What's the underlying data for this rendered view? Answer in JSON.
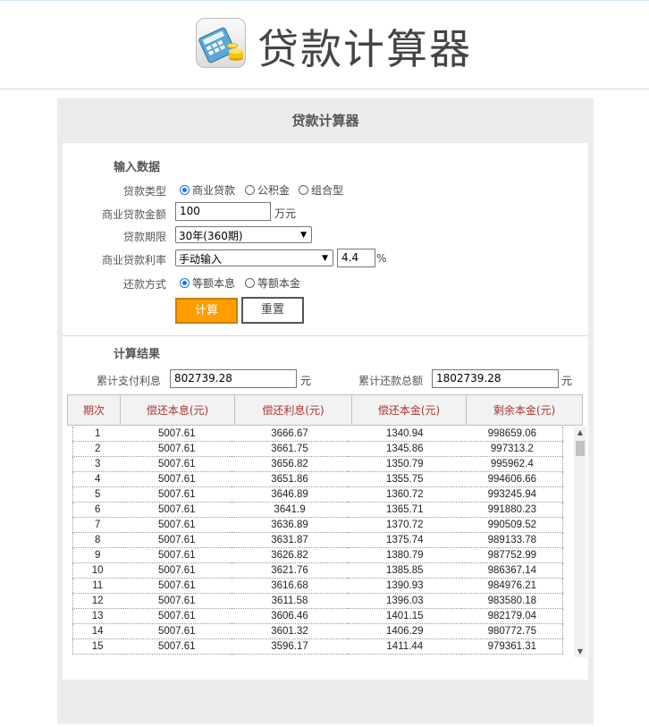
{
  "header": {
    "app_title": "贷款计算器",
    "logo_icon": "calculator-coins-icon"
  },
  "panel": {
    "title": "贷款计算器"
  },
  "input_section": {
    "title": "输入数据",
    "loan_type_label": "贷款类型",
    "loan_type_options": [
      "商业贷款",
      "公积金",
      "组合型"
    ],
    "loan_type_selected": "商业贷款",
    "amount_label": "商业贷款金额",
    "amount_value": "100",
    "amount_unit": "万元",
    "term_label": "贷款期限",
    "term_value": "30年(360期)",
    "rate_label": "商业贷款利率",
    "rate_mode_value": "手动输入",
    "rate_value": "4.4",
    "rate_unit": "%",
    "method_label": "还款方式",
    "method_options": [
      "等额本息",
      "等额本金"
    ],
    "method_selected": "等额本息",
    "calc_button": "计算",
    "reset_button": "重置"
  },
  "result_section": {
    "title": "计算结果",
    "total_interest_label": "累计支付利息",
    "total_interest_value": "802739.28",
    "total_interest_unit": "元",
    "total_payment_label": "累计还款总额",
    "total_payment_value": "1802739.28",
    "total_payment_unit": "元"
  },
  "schedule": {
    "columns": [
      "期次",
      "偿还本息(元)",
      "偿还利息(元)",
      "偿还本金(元)",
      "剩余本金(元)"
    ],
    "rows": [
      [
        "1",
        "5007.61",
        "3666.67",
        "1340.94",
        "998659.06"
      ],
      [
        "2",
        "5007.61",
        "3661.75",
        "1345.86",
        "997313.2"
      ],
      [
        "3",
        "5007.61",
        "3656.82",
        "1350.79",
        "995962.4"
      ],
      [
        "4",
        "5007.61",
        "3651.86",
        "1355.75",
        "994606.66"
      ],
      [
        "5",
        "5007.61",
        "3646.89",
        "1360.72",
        "993245.94"
      ],
      [
        "6",
        "5007.61",
        "3641.9",
        "1365.71",
        "991880.23"
      ],
      [
        "7",
        "5007.61",
        "3636.89",
        "1370.72",
        "990509.52"
      ],
      [
        "8",
        "5007.61",
        "3631.87",
        "1375.74",
        "989133.78"
      ],
      [
        "9",
        "5007.61",
        "3626.82",
        "1380.79",
        "987752.99"
      ],
      [
        "10",
        "5007.61",
        "3621.76",
        "1385.85",
        "986367.14"
      ],
      [
        "11",
        "5007.61",
        "3616.68",
        "1390.93",
        "984976.21"
      ],
      [
        "12",
        "5007.61",
        "3611.58",
        "1396.03",
        "983580.18"
      ],
      [
        "13",
        "5007.61",
        "3606.46",
        "1401.15",
        "982179.04"
      ],
      [
        "14",
        "5007.61",
        "3601.32",
        "1406.29",
        "980772.75"
      ],
      [
        "15",
        "5007.61",
        "3596.17",
        "1411.44",
        "979361.31"
      ]
    ]
  },
  "colors": {
    "accent_orange": "#ff9c00",
    "header_text_red": "#aa3333",
    "radio_blue": "#1a73e8"
  }
}
